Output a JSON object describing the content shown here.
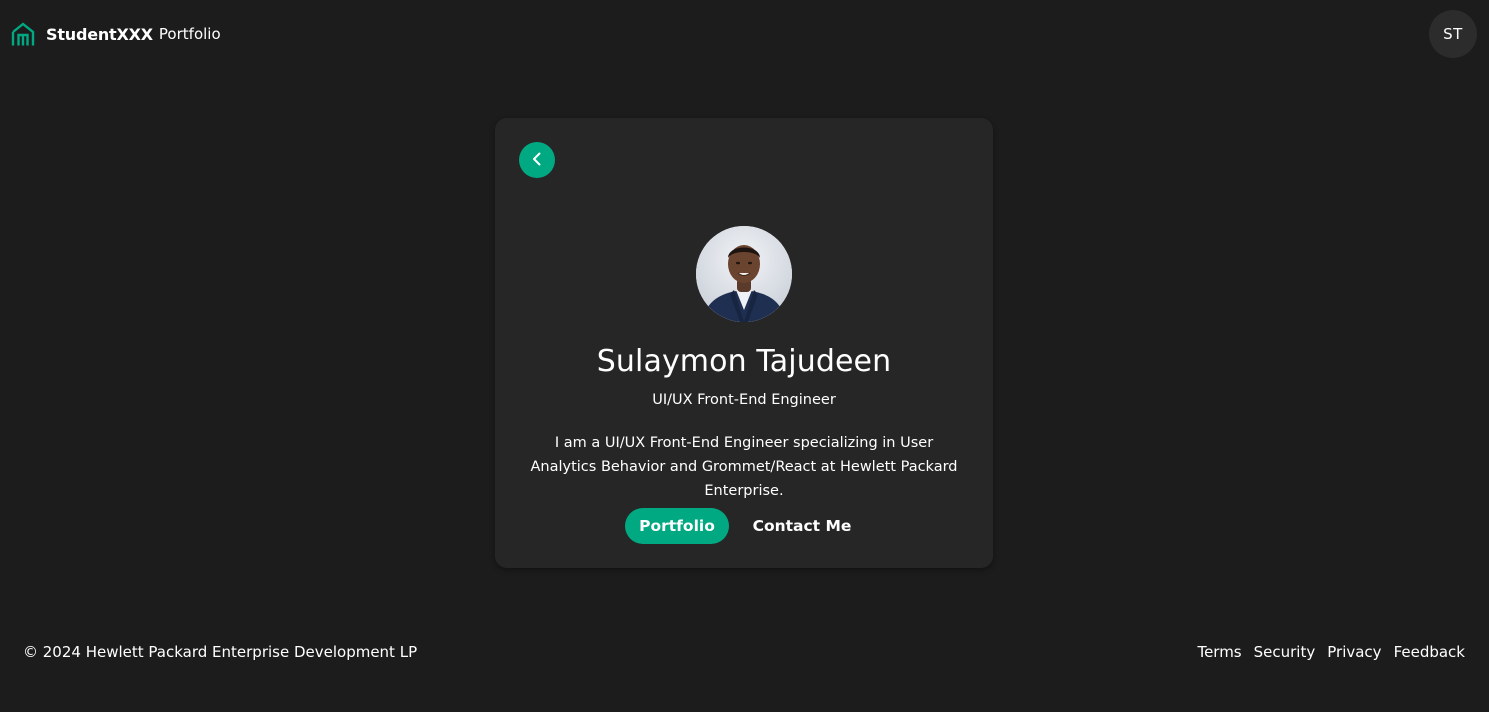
{
  "header": {
    "brand_name": "StudentXXX",
    "brand_sub": "Portfolio",
    "avatar_initials": "ST",
    "brand_icon": "home-icon"
  },
  "profile": {
    "name": "Sulaymon Tajudeen",
    "role": "UI/UX Front-End Engineer",
    "bio": "I am a UI/UX Front-End Engineer specializing in User Analytics Behavior and Grommet/React at Hewlett Packard Enterprise.",
    "photo": "profile-photo"
  },
  "actions": {
    "back_icon": "chevron-left-icon",
    "portfolio_label": "Portfolio",
    "contact_label": "Contact Me"
  },
  "footer": {
    "copyright": "© 2024 Hewlett Packard Enterprise Development LP",
    "links": [
      "Terms",
      "Security",
      "Privacy",
      "Feedback"
    ]
  },
  "colors": {
    "background": "#1c1c1c",
    "card": "#262626",
    "accent": "#01a982",
    "text": "#ffffff"
  }
}
